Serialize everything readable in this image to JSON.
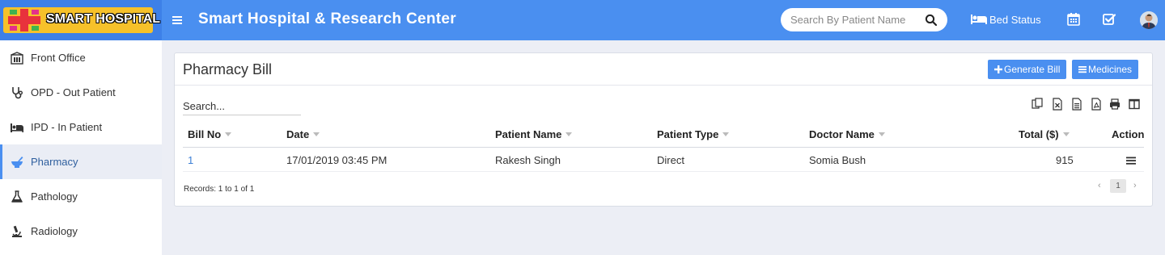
{
  "brand": {
    "logo_text": "SMART HOSPITAL",
    "app_title": "Smart Hospital & Research Center",
    "colors": {
      "topbar": "#4a8ff0",
      "logo_badge": "#f6c12a",
      "cross_red": "#e8323c",
      "cross_green": "#3fb34f",
      "cross_pink": "#e4318a",
      "accent": "#4a8ff0"
    }
  },
  "header": {
    "search_placeholder": "Search By Patient Name",
    "bed_status_label": "Bed Status",
    "icons": [
      "menu-icon",
      "search-icon",
      "bed-icon",
      "calendar-icon",
      "task-check-icon",
      "user-avatar"
    ]
  },
  "sidebar": {
    "items": [
      {
        "label": "Front Office",
        "icon": "front-office-icon",
        "active": false
      },
      {
        "label": "OPD - Out Patient",
        "icon": "stethoscope-icon",
        "active": false
      },
      {
        "label": "IPD - In Patient",
        "icon": "bed-icon",
        "active": false
      },
      {
        "label": "Pharmacy",
        "icon": "mortar-pestle-icon",
        "active": true
      },
      {
        "label": "Pathology",
        "icon": "flask-icon",
        "active": false
      },
      {
        "label": "Radiology",
        "icon": "microscope-icon",
        "active": false
      }
    ]
  },
  "panel": {
    "title": "Pharmacy Bill",
    "generate_bill_label": "Generate Bill",
    "medicines_label": "Medicines",
    "search_placeholder": "Search...",
    "export_icons": [
      "copy-icon",
      "excel-icon",
      "csv-icon",
      "pdf-icon",
      "print-icon",
      "columns-icon"
    ]
  },
  "table": {
    "columns": [
      "Bill No",
      "Date",
      "Patient Name",
      "Patient Type",
      "Doctor Name",
      "Total ($)",
      "Action"
    ],
    "rows": [
      {
        "bill_no": "1",
        "date": "17/01/2019 03:45 PM",
        "patient_name": "Rakesh Singh",
        "patient_type": "Direct",
        "doctor_name": "Somia Bush",
        "total": "915"
      }
    ],
    "records_text": "Records: 1 to 1 of 1",
    "pagination": {
      "prev": "‹",
      "current": "1",
      "next": "›"
    }
  }
}
